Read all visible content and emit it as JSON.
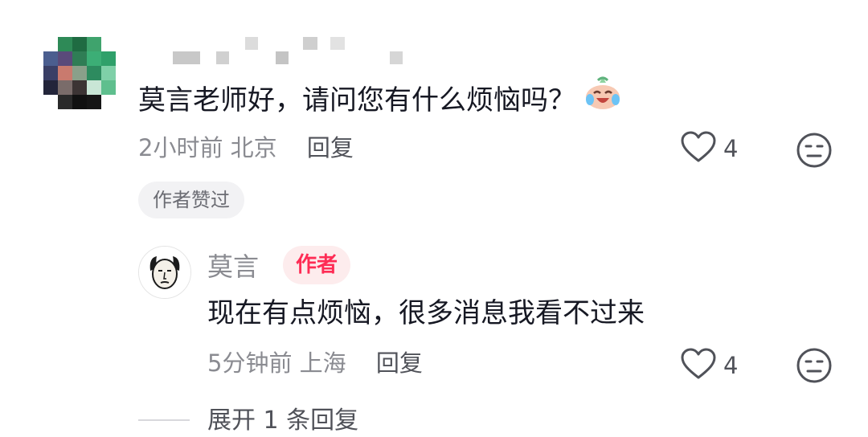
{
  "comment": {
    "text": "莫言老师好，请问您有什么烦恼吗？",
    "time": "2小时前",
    "location": "北京",
    "reply_label": "回复",
    "likes": "4",
    "liked_by_author_label": "作者赞过",
    "emoji_icon": "laughing-crying-emoji-icon"
  },
  "reply": {
    "author": "莫言",
    "badge": "作者",
    "text": "现在有点烦恼，很多消息我看不过来",
    "time": "5分钟前",
    "location": "上海",
    "reply_label": "回复",
    "likes": "4"
  },
  "expand_label": "展开 1 条回复",
  "colors": {
    "accent": "#fe2c55",
    "text_primary": "#161823",
    "text_secondary": "#8a8b91"
  }
}
